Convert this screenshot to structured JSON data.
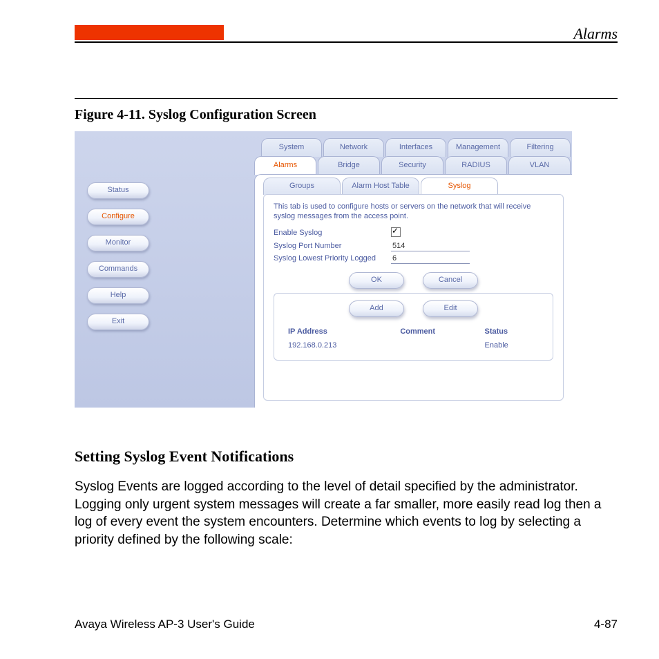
{
  "header": {
    "section": "Alarms"
  },
  "figure": {
    "caption": "Figure 4-11.   Syslog Configuration Screen"
  },
  "nav": {
    "items": [
      "Status",
      "Configure",
      "Monitor",
      "Commands",
      "Help",
      "Exit"
    ],
    "active_index": 1
  },
  "tabs_row1": [
    "System",
    "Network",
    "Interfaces",
    "Management",
    "Filtering"
  ],
  "tabs_row2": [
    "Alarms",
    "Bridge",
    "Security",
    "RADIUS",
    "VLAN"
  ],
  "tabs_row2_active": 0,
  "subtabs": [
    "Groups",
    "Alarm Host Table",
    "Syslog"
  ],
  "subtabs_active": 2,
  "syslog": {
    "description": "This tab is used to configure hosts or servers on the network that will receive syslog messages from the access point.",
    "enable_label": "Enable Syslog",
    "enable_checked": true,
    "port_label": "Syslog Port Number",
    "port_value": "514",
    "priority_label": "Syslog Lowest Priority Logged",
    "priority_value": "6",
    "buttons": {
      "ok": "OK",
      "cancel": "Cancel",
      "add": "Add",
      "edit": "Edit"
    },
    "table": {
      "headers": {
        "ip": "IP Address",
        "comment": "Comment",
        "status": "Status"
      },
      "rows": [
        {
          "ip": "192.168.0.213",
          "comment": "",
          "status": "Enable"
        }
      ]
    }
  },
  "body": {
    "heading": "Setting Syslog Event Notifications",
    "text": "Syslog Events are logged according to the level of detail specified by the administrator. Logging only urgent system messages will create a far smaller, more easily read log then a log of every event the system encounters. Determine which events to log by selecting a priority defined by the following scale:"
  },
  "footer": {
    "left": "Avaya Wireless AP-3 User's Guide",
    "right": "4-87"
  }
}
